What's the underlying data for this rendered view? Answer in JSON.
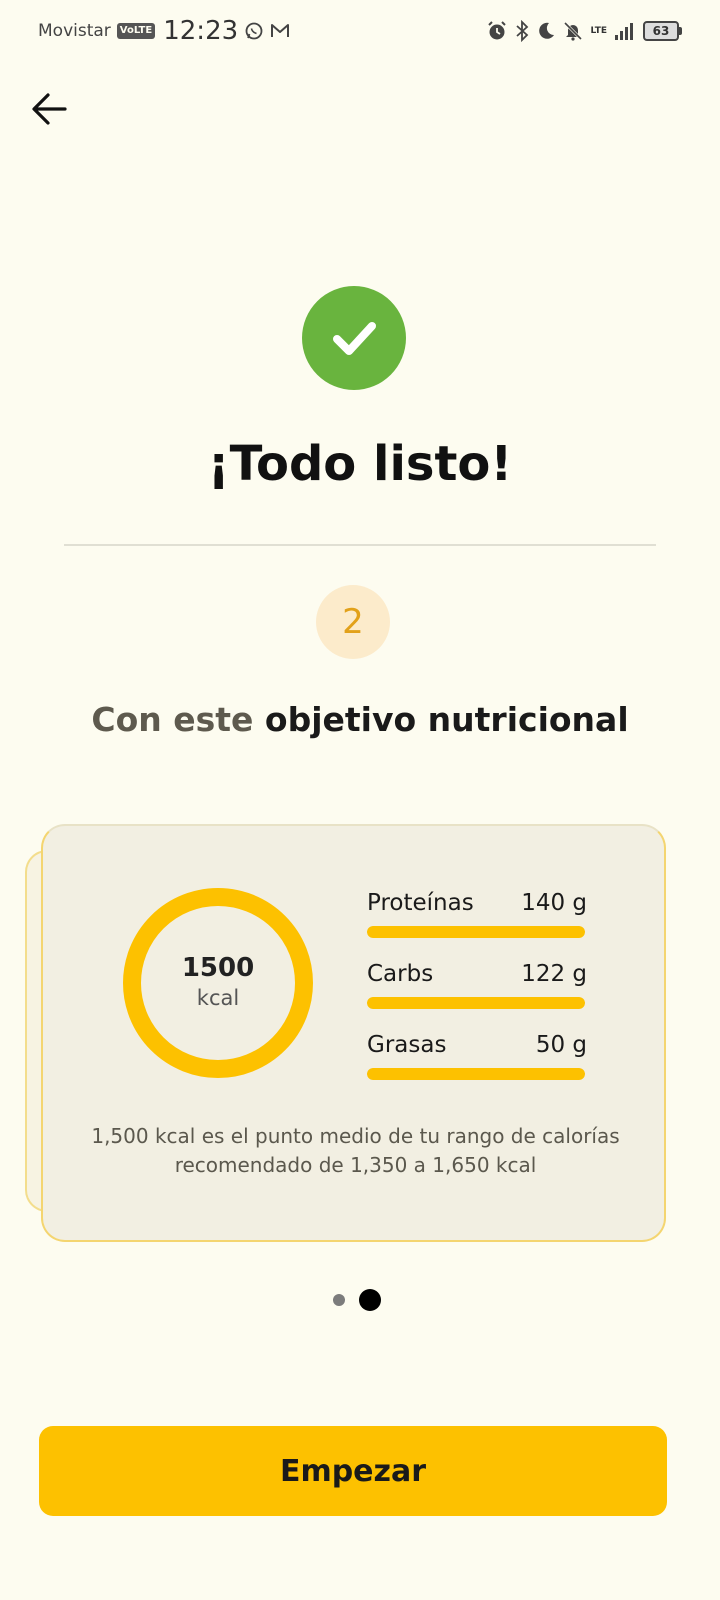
{
  "status_bar": {
    "carrier": "Movistar",
    "volte": "VoLTE",
    "time": "12:23",
    "network": "LTE",
    "battery": "63"
  },
  "header": {
    "back_icon": "arrow-left-icon"
  },
  "success": {
    "icon": "check-circle-icon",
    "title": "¡Todo listo!"
  },
  "step": {
    "number": "2",
    "label_muted": "Con este",
    "label_strong": "objetivo nutricional"
  },
  "nutrition_card": {
    "calories_value": "1500",
    "calories_unit": "kcal",
    "macros": [
      {
        "name": "Proteínas",
        "amount": "140 g",
        "fill": 1.0
      },
      {
        "name": "Carbs",
        "amount": "122 g",
        "fill": 1.0
      },
      {
        "name": "Grasas",
        "amount": "50 g",
        "fill": 1.0
      }
    ],
    "note": "1,500 kcal es el punto medio de tu rango de calorías recomendado de 1,350 a 1,650 kcal"
  },
  "pager": {
    "pages": 2,
    "active_index": 1
  },
  "cta": {
    "label": "Empezar"
  },
  "colors": {
    "background": "#fdfcf0",
    "accent": "#fdc100",
    "success": "#69b43e",
    "step_badge_bg": "#fcebcb",
    "step_badge_text": "#e2a11a"
  }
}
